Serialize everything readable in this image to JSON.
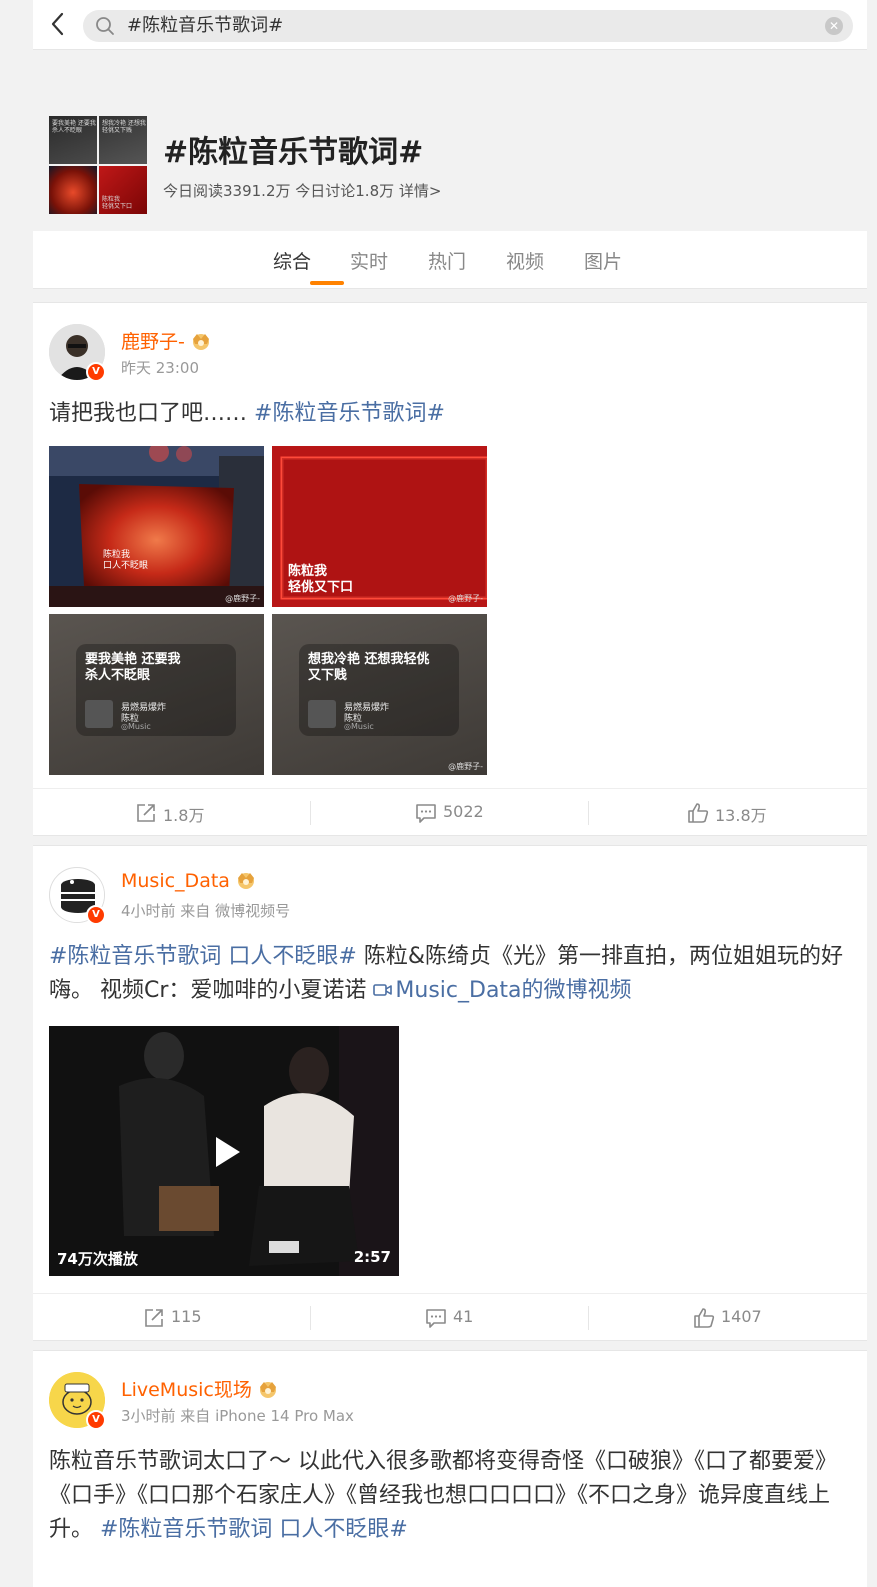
{
  "search": {
    "query": "#陈粒音乐节歌词#",
    "clear_icon": "clear-icon"
  },
  "topic": {
    "title": "#陈粒音乐节歌词#",
    "stats": "今日阅读3391.2万 今日讨论1.8万 详情>",
    "thumb_texts": [
      "要我美艳 还要我\n杀人不眨眼",
      "想我冷艳 还想我\n轻佻又下贱",
      "",
      "陈粒我\n轻佻又下口"
    ]
  },
  "tabs": [
    "综合",
    "实时",
    "热门",
    "视频",
    "图片"
  ],
  "active_tab": "综合",
  "accent_color": "#ff8200",
  "link_color": "#4a6ea3",
  "username_color": "#ff6100",
  "posts": [
    {
      "user": "鹿野子-",
      "meta": "昨天 23:00",
      "text": "请把我也口了吧……",
      "tag": "#陈粒音乐节歌词#",
      "images": [
        {
          "caption": "陈粒我\n口人不眨眼",
          "watermark": "@鹿野子-"
        },
        {
          "caption": "陈粒我\n轻佻又下口",
          "watermark": "@鹿野子-"
        },
        {
          "lyric": "要我美艳 还要我\n杀人不眨眼",
          "song": "易燃易爆炸",
          "artist": "陈粒",
          "app": "◎Music"
        },
        {
          "lyric": "想我冷艳 还想我轻佻\n又下贱",
          "song": "易燃易爆炸",
          "artist": "陈粒",
          "app": "◎Music",
          "watermark": "@鹿野子-"
        }
      ],
      "reposts": "1.8万",
      "comments": "5022",
      "likes": "13.8万"
    },
    {
      "user": "Music_Data",
      "meta": "4小时前 来自 微博视频号",
      "tag": "#陈粒音乐节歌词 口人不眨眼#",
      "text": " 陈粒&陈绮贞《光》第一排直拍，两位姐姐玩的好嗨。 视频Cr：爱咖啡的小夏诺诺 ",
      "video_link": "Music_Data的微博视频",
      "video": {
        "plays": "74万次播放",
        "duration": "2:57"
      },
      "reposts": "115",
      "comments": "41",
      "likes": "1407"
    },
    {
      "user": "LiveMusic现场",
      "meta": "3小时前 来自 iPhone 14 Pro Max",
      "text": "陈粒音乐节歌词太口了～ 以此代入很多歌都将变得奇怪《口破狼》《口了都要爱》《口手》《口口那个石家庄人》《曾经我也想口口口口》《不口之身》诡异度直线上升。 ",
      "tag": "#陈粒音乐节歌词 口人不眨眼#"
    }
  ]
}
